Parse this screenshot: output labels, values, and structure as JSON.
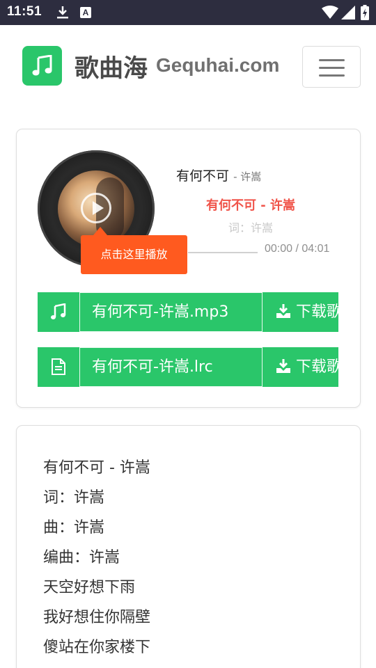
{
  "status_bar": {
    "time": "11:51",
    "icons": [
      "download-icon",
      "a-badge-icon",
      "wifi-icon",
      "signal-icon",
      "battery-icon"
    ],
    "a_badge": "A"
  },
  "header": {
    "site_name": "歌曲海",
    "site_domain": "Gequhai.com",
    "logo_icon": "music-note-icon",
    "menu_icon": "hamburger-menu-icon"
  },
  "player": {
    "song_title": "有何不可",
    "artist_suffix": "- 许嵩",
    "lyric_current": "有何不可 - 许嵩",
    "lyric_next": "词：许嵩",
    "time": "00:00 / 04:01",
    "progress": 0.0,
    "play_tooltip": "点击这里播放"
  },
  "downloads": [
    {
      "icon": "music-note-icon",
      "filename": "有何不可-许嵩.mp3",
      "button": "下载歌曲",
      "button_icon": "download-icon"
    },
    {
      "icon": "document-icon",
      "filename": "有何不可-许嵩.lrc",
      "button": "下载歌词",
      "button_icon": "download-icon"
    }
  ],
  "lyrics": [
    "有何不可 - 许嵩",
    "词：许嵩",
    "曲：许嵩",
    "编曲：许嵩",
    "天空好想下雨",
    "我好想住你隔壁",
    "傻站在你家楼下"
  ],
  "colors": {
    "accent_green": "#2ac66a",
    "tooltip_orange": "#ff5a1f",
    "lyric_red": "#f0544a",
    "status_bar": "#2d2d3f"
  }
}
